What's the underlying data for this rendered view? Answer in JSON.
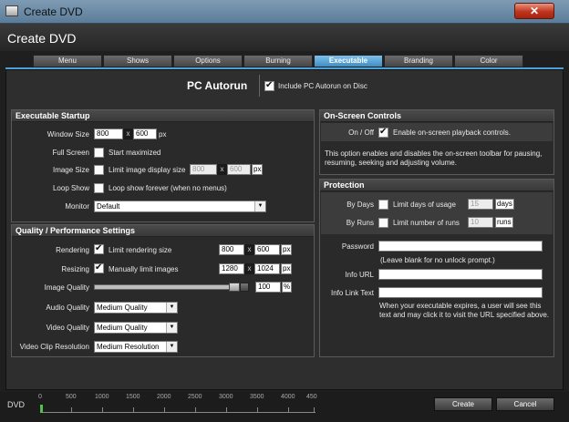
{
  "window": {
    "title": "Create DVD",
    "app_title": "Create DVD",
    "close_glyph": "✕"
  },
  "tabs": [
    {
      "label": "Menu"
    },
    {
      "label": "Shows"
    },
    {
      "label": "Options"
    },
    {
      "label": "Burning"
    },
    {
      "label": "Executable",
      "active": true
    },
    {
      "label": "Branding"
    },
    {
      "label": "Color"
    }
  ],
  "autorun": {
    "title": "PC Autorun",
    "include_label": "Include PC Autorun on Disc",
    "include_checked": true
  },
  "exec_startup": {
    "title": "Executable Startup",
    "window_size_label": "Window Size",
    "window_w": "800",
    "window_h": "600",
    "x": "x",
    "px": "px",
    "full_screen_label": "Full Screen",
    "start_maximized": "Start maximized",
    "image_size_label": "Image Size",
    "limit_display": "Limit image display size",
    "img_w": "800",
    "img_h": "600",
    "loop_show_label": "Loop Show",
    "loop_forever": "Loop show forever (when no menus)",
    "monitor_label": "Monitor",
    "monitor_value": "Default"
  },
  "quality": {
    "title": "Quality / Performance Settings",
    "rendering_label": "Rendering",
    "limit_rendering": "Limit rendering size",
    "render_w": "800",
    "render_h": "600",
    "resizing_label": "Resizing",
    "manually_limit": "Manually limit images",
    "resize_w": "1280",
    "resize_h": "1024",
    "image_quality_label": "Image Quality",
    "image_quality_value": "100",
    "percent": "%",
    "audio_quality_label": "Audio Quality",
    "audio_quality_value": "Medium Quality",
    "video_quality_label": "Video Quality",
    "video_quality_value": "Medium Quality",
    "video_clip_label": "Video Clip Resolution",
    "video_clip_value": "Medium Resolution"
  },
  "onscreen": {
    "title": "On-Screen Controls",
    "onoff_label": "On / Off",
    "enable_label": "Enable on-screen playback controls.",
    "description": "This option enables and disables the on-screen toolbar for pausing, resuming, seeking and adjusting volume."
  },
  "protection": {
    "title": "Protection",
    "by_days_label": "By Days",
    "limit_days": "Limit days of usage",
    "days_value": "15",
    "days_unit": "days",
    "by_runs_label": "By Runs",
    "limit_runs": "Limit number of runs",
    "runs_value": "10",
    "runs_unit": "runs",
    "password_label": "Password",
    "password_hint": "(Leave blank for no unlock prompt.)",
    "info_url_label": "Info URL",
    "info_link_label": "Info Link Text",
    "expire_note": "When your executable expires, a user will see this text and may click it to visit the URL specified above."
  },
  "bottom": {
    "dvd_label": "DVD",
    "ruler_labels": [
      "0",
      "500",
      "1000",
      "1500",
      "2000",
      "2500",
      "3000",
      "3500",
      "4000",
      "450"
    ],
    "create_label": "Create",
    "cancel_label": "Cancel"
  }
}
